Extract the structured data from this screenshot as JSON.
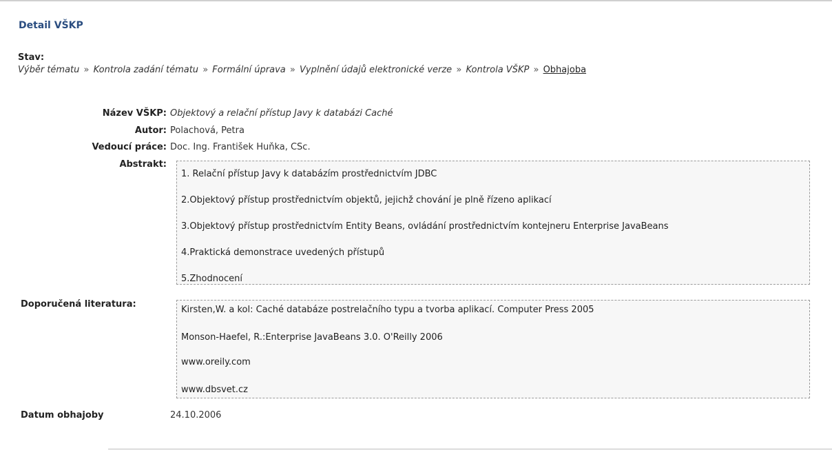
{
  "page": {
    "title": "Detail VŠKP",
    "stav_label": "Stav:",
    "stav_steps": [
      "Výběr tématu",
      "Kontrola zadání tématu",
      "Formální úprava",
      "Vyplnění údajů elektronické verze",
      "Kontrola VŠKP"
    ],
    "stav_separator": "»",
    "stav_current": "Obhajoba"
  },
  "detail": {
    "nazev_label": "Název VŠKP:",
    "nazev_value": "Objektový a relační přístup Javy k databázi Caché",
    "autor_label": "Autor:",
    "autor_value": "Polachová, Petra",
    "vedouci_label": "Vedoucí práce:",
    "vedouci_value": "Doc. Ing. František Huňka, CSc.",
    "abstrakt_label": "Abstrakt:",
    "abstrakt_items": [
      "1. Relační přístup Javy k databázím prostřednictvím JDBC",
      "2.Objektový přístup prostřednictvím objektů, jejichž chování je plně řízeno aplikací",
      "3.Objektový přístup prostřednictvím Entity Beans, ovládání prostřednictvím kontejneru Enterprise JavaBeans",
      "4.Praktická demonstrace uvedených přístupů",
      "5.Zhodnocení"
    ],
    "literatura_label": "Doporučená literatura:",
    "literatura_items": [
      "Kirsten,W. a kol: Caché databáze postrelačního typu a tvorba aplikací. Computer Press 2005",
      "Monson-Haefel, R.:Enterprise JavaBeans 3.0. O'Reilly 2006",
      "www.oreily.com",
      "www.dbsvet.cz"
    ],
    "datum_label": "Datum obhajoby",
    "datum_value": "24.10.2006"
  }
}
